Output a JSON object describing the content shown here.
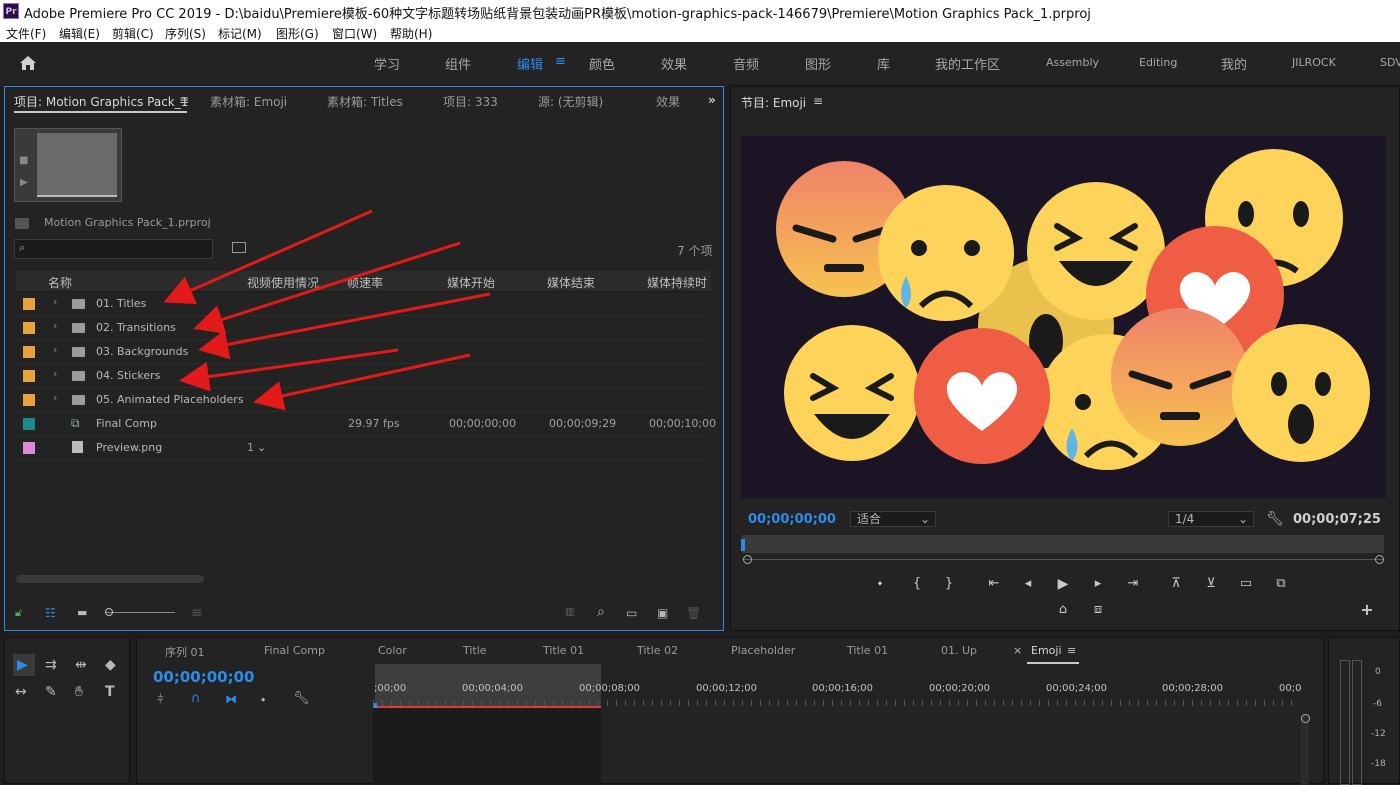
{
  "window": {
    "title": "Adobe Premiere Pro CC 2019 - D:\\baidu\\Premiere模板-60种文字标题转场贴纸背景包装动画PR模板\\motion-graphics-pack-146679\\Premiere\\Motion Graphics Pack_1.prproj",
    "logo": "Pr"
  },
  "menu": [
    "文件(F)",
    "编辑(E)",
    "剪辑(C)",
    "序列(S)",
    "标记(M)",
    "图形(G)",
    "窗口(W)",
    "帮助(H)"
  ],
  "workspaces": [
    "学习",
    "组件",
    "编辑",
    "颜色",
    "效果",
    "音频",
    "图形",
    "库",
    "我的工作区",
    "Assembly",
    "Editing",
    "我的",
    "JILROCK",
    "SDV"
  ],
  "project": {
    "tabs": [
      "项目: Motion Graphics Pack_1",
      "素材箱: Emoji",
      "素材箱: Titles",
      "项目: 333",
      "源: (无剪辑)",
      "效果"
    ],
    "file_name": "Motion Graphics Pack_1.prproj",
    "item_count": "7 个项",
    "columns": [
      "名称",
      "视频使用情况",
      "帧速率",
      "媒体开始",
      "媒体结束",
      "媒体持续时"
    ],
    "rows": [
      {
        "name": "01. Titles",
        "color": "#e8a23a",
        "type": "folder",
        "fps": "",
        "start": "",
        "end": "",
        "dur": "",
        "usage": ""
      },
      {
        "name": "02. Transitions",
        "color": "#e8a23a",
        "type": "folder",
        "fps": "",
        "start": "",
        "end": "",
        "dur": "",
        "usage": ""
      },
      {
        "name": "03. Backgrounds",
        "color": "#e8a23a",
        "type": "folder",
        "fps": "",
        "start": "",
        "end": "",
        "dur": "",
        "usage": ""
      },
      {
        "name": "04. Stickers",
        "color": "#e8a23a",
        "type": "folder",
        "fps": "",
        "start": "",
        "end": "",
        "dur": "",
        "usage": ""
      },
      {
        "name": "05. Animated Placeholders",
        "color": "#e8a23a",
        "type": "folder",
        "fps": "",
        "start": "",
        "end": "",
        "dur": "",
        "usage": ""
      },
      {
        "name": "Final Comp",
        "color": "#1a8a8a",
        "type": "sequence",
        "fps": "29.97 fps",
        "start": "00;00;00;00",
        "end": "00;00;09;29",
        "dur": "00;00;10;00",
        "usage": ""
      },
      {
        "name": "Preview.png",
        "color": "#d98ad9",
        "type": "image",
        "fps": "",
        "start": "",
        "end": "",
        "dur": "",
        "usage": "1"
      }
    ]
  },
  "program": {
    "title": "节目: Emoji",
    "timecode_left": "00;00;00;00",
    "fit": "适合",
    "quality": "1/4",
    "timecode_right": "00;00;07;25"
  },
  "timeline": {
    "tabs": [
      "序列 01",
      "Final Comp",
      "Color",
      "Title",
      "Title 01",
      "Title 02",
      "Placeholder",
      "Title 01",
      "01. Up",
      "Emoji"
    ],
    "timecode": "00;00;00;00",
    "ruler": [
      ";00;00",
      "00;00;04;00",
      "00;00;08;00",
      "00;00;12;00",
      "00;00;16;00",
      "00;00;20;00",
      "00;00;24;00",
      "00;00;28;00",
      "00;0"
    ]
  },
  "meter": {
    "labels": [
      "0",
      "-6",
      "-12",
      "-18"
    ]
  },
  "colors": {
    "accent": "#2d8ceb",
    "folder_label": "#e8a23a",
    "sequence_label": "#1a8a8a",
    "image_label": "#d98ad9",
    "arrow": "#e21a1a"
  }
}
